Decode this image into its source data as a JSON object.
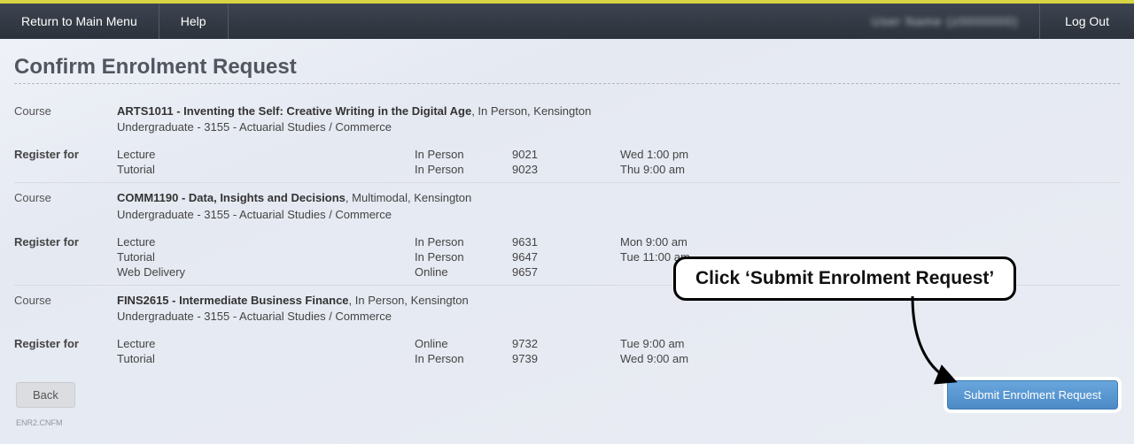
{
  "nav": {
    "return": "Return to Main Menu",
    "help": "Help",
    "user": "User Name (z0000000)",
    "logout": "Log Out"
  },
  "pageTitle": "Confirm Enrolment Request",
  "labels": {
    "course": "Course",
    "registerFor": "Register for"
  },
  "courses": [
    {
      "titleBold": "ARTS1011 - Inventing the Self: Creative Writing in the Digital Age",
      "titleRest": ", In Person, Kensington",
      "subline": "Undergraduate - 3155 - Actuarial Studies / Commerce",
      "classes": [
        {
          "type": "Lecture",
          "mode": "In Person",
          "classNo": "9021",
          "time": "Wed 1:00 pm"
        },
        {
          "type": "Tutorial",
          "mode": "In Person",
          "classNo": "9023",
          "time": "Thu 9:00 am"
        }
      ]
    },
    {
      "titleBold": "COMM1190 - Data, Insights and Decisions",
      "titleRest": ", Multimodal, Kensington",
      "subline": "Undergraduate - 3155 - Actuarial Studies / Commerce",
      "classes": [
        {
          "type": "Lecture",
          "mode": "In Person",
          "classNo": "9631",
          "time": "Mon 9:00 am"
        },
        {
          "type": "Tutorial",
          "mode": "In Person",
          "classNo": "9647",
          "time": "Tue 11:00 am"
        },
        {
          "type": "Web Delivery",
          "mode": "Online",
          "classNo": "9657",
          "time": ""
        }
      ]
    },
    {
      "titleBold": "FINS2615 - Intermediate Business Finance",
      "titleRest": ", In Person, Kensington",
      "subline": "Undergraduate - 3155 - Actuarial Studies / Commerce",
      "classes": [
        {
          "type": "Lecture",
          "mode": "Online",
          "classNo": "9732",
          "time": "Tue 9:00 am"
        },
        {
          "type": "Tutorial",
          "mode": "In Person",
          "classNo": "9739",
          "time": "Wed 9:00 am"
        }
      ]
    }
  ],
  "buttons": {
    "back": "Back",
    "submit": "Submit Enrolment Request"
  },
  "pageCode": "ENR2.CNFM",
  "annotation": "Click ‘Submit Enrolment Request’"
}
